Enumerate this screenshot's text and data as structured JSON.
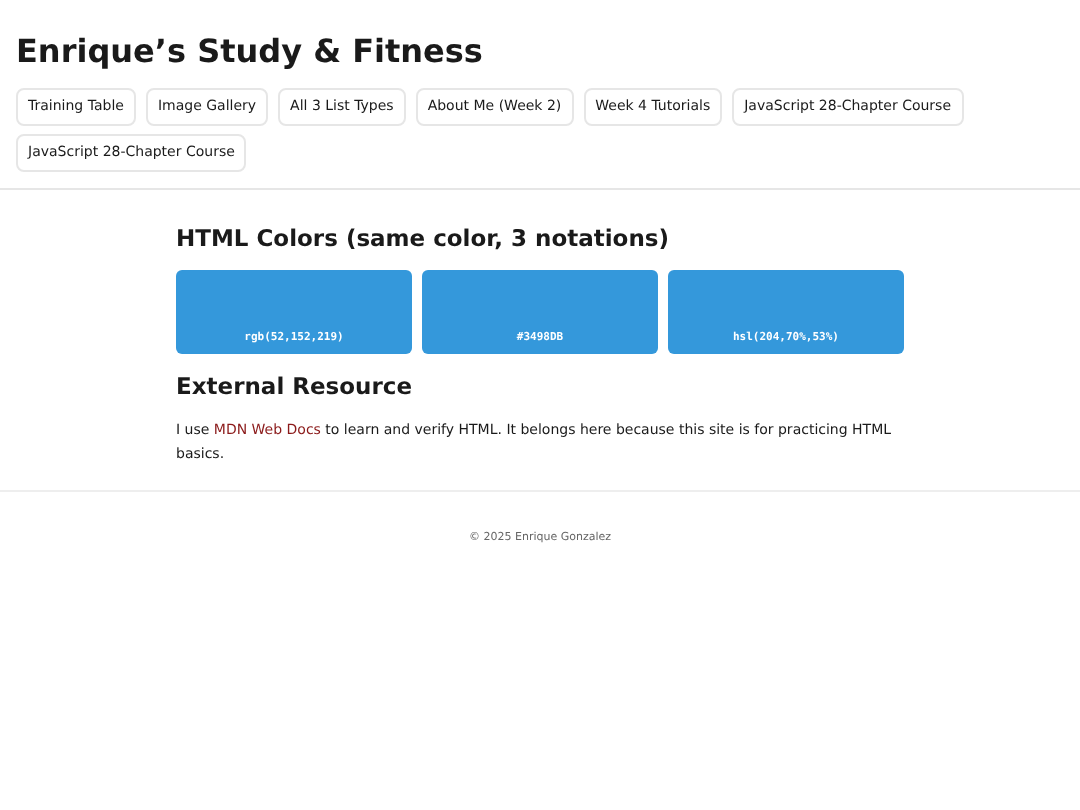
{
  "site_title": "Enrique’s Study & Fitness",
  "nav": [
    "Training Table",
    "Image Gallery",
    "All 3 List Types",
    "About Me (Week 2)",
    "Week 4 Tutorials",
    "JavaScript 28-Chapter Course",
    "JavaScript 28-Chapter Course"
  ],
  "colors_heading": "HTML Colors (same color, 3 notations)",
  "swatches": [
    {
      "label": "rgb(52,152,219)",
      "color": "#3498db"
    },
    {
      "label": "#3498DB",
      "color": "#3498db"
    },
    {
      "label": "hsl(204,70%,53%)",
      "color": "#3498db"
    }
  ],
  "resource_heading": "External Resource",
  "resource_text": {
    "before": "I use",
    "link": "MDN Web Docs",
    "after": "to learn and verify HTML. It belongs here because this site is for practicing HTML basics."
  },
  "footer": "© 2025 Enrique Gonzalez"
}
